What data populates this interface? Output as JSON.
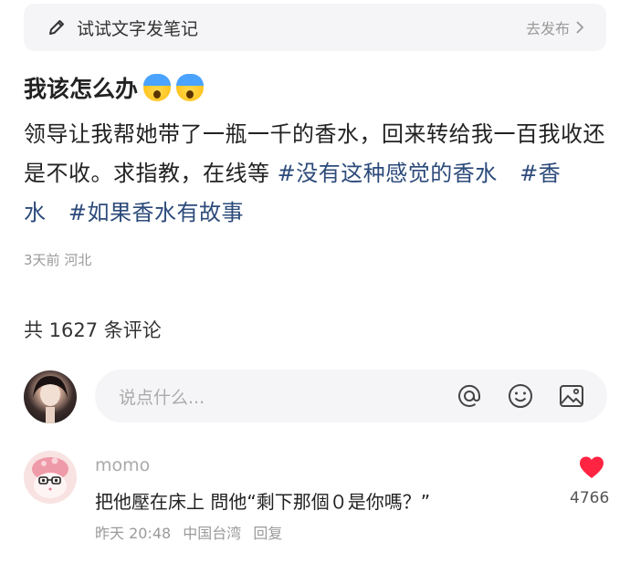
{
  "note_bar": {
    "label": "试试文字发笔记",
    "publish": "去发布"
  },
  "post": {
    "title": "我该怎么办",
    "body_text": "领导让我帮她带了一瓶一千的香水，回来转给我一百我收还是不收。求指教，在线等 ",
    "tags": [
      "#没有这种感觉的香水",
      "#香水",
      "#如果香水有故事"
    ],
    "time": "3天前",
    "location": "河北"
  },
  "comments_header": "共 1627 条评论",
  "comment_input": {
    "placeholder": "说点什么..."
  },
  "comment": {
    "user": "momo",
    "text": "把他壓在床上 問他“剩下那個０是你嗎？”",
    "time": "昨天 20:48",
    "location": "中国台湾",
    "reply": "回复",
    "likes": "4766"
  },
  "colors": {
    "tag": "#2c4a7a",
    "like": "#ff2442",
    "muted": "#9a9a9a"
  }
}
